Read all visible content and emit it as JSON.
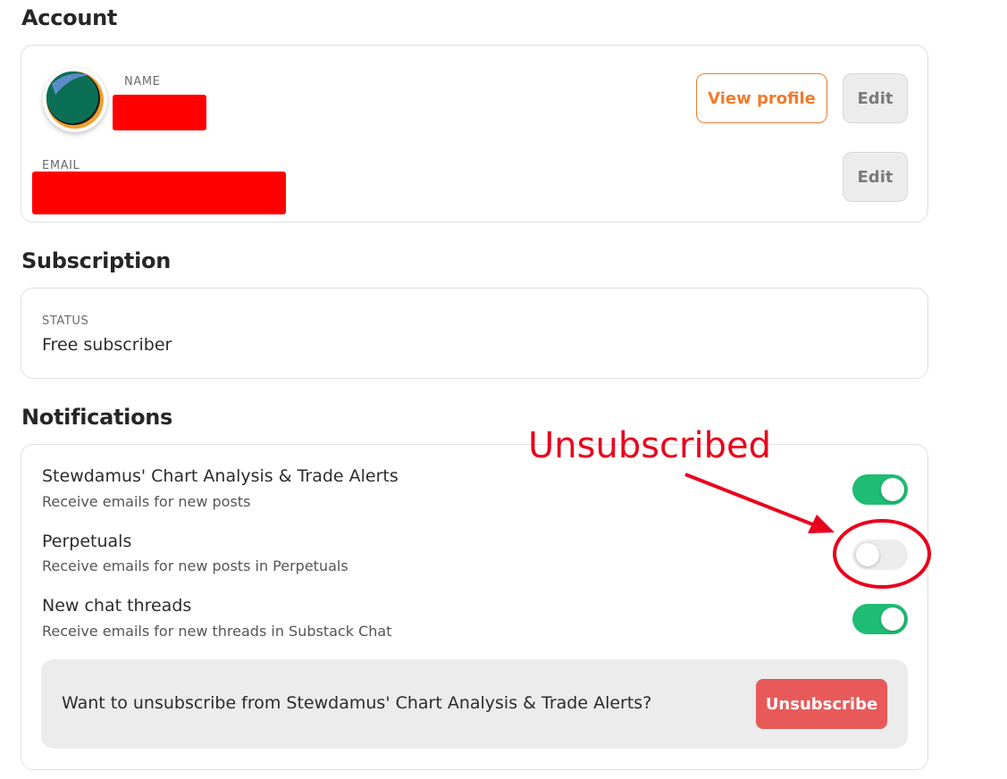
{
  "account": {
    "title": "Account",
    "name_label": "NAME",
    "email_label": "EMAIL",
    "view_profile_label": "View profile",
    "edit_name_label": "Edit",
    "edit_email_label": "Edit"
  },
  "subscription": {
    "title": "Subscription",
    "status_label": "STATUS",
    "status_value": "Free subscriber"
  },
  "notifications": {
    "title": "Notifications",
    "items": [
      {
        "title": "Stewdamus' Chart Analysis & Trade Alerts",
        "subtitle": "Receive emails for new posts",
        "enabled": true
      },
      {
        "title": "Perpetuals",
        "subtitle": "Receive emails for new posts in Perpetuals",
        "enabled": false
      },
      {
        "title": "New chat threads",
        "subtitle": "Receive emails for new threads in Substack Chat",
        "enabled": true
      }
    ],
    "unsubscribe_prompt": "Want to unsubscribe from Stewdamus' Chart Analysis & Trade Alerts?",
    "unsubscribe_label": "Unsubscribe"
  },
  "annotation": {
    "text": "Unsubscribed",
    "color": "#e8001c"
  },
  "colors": {
    "accent": "#f07b2b",
    "toggle_on": "#1ebd73",
    "danger": "#e85a5a",
    "redaction": "#ff0000"
  }
}
